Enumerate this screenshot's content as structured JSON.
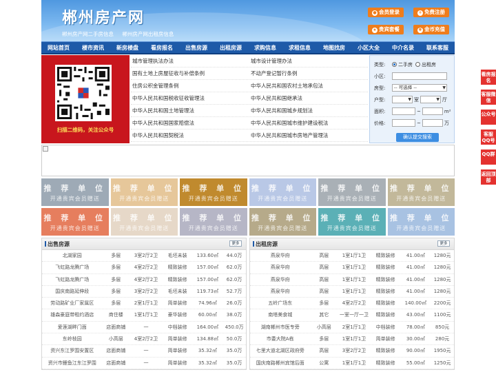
{
  "header": {
    "logo": "郴州房产网",
    "slogan1": "郴州房产网二手房信息",
    "slogan2": "郴州房产网出租房信息",
    "buttons": [
      {
        "label": "会员登录",
        "icon": "user-icon"
      },
      {
        "label": "免费注册",
        "icon": "register-icon"
      },
      {
        "label": "贵宾套餐",
        "icon": "vip-icon"
      },
      {
        "label": "金币充值",
        "icon": "coin-icon"
      }
    ]
  },
  "nav": [
    "网站首页",
    "楼市资讯",
    "新房楼盘",
    "看房报名",
    "出售房源",
    "出租房源",
    "求购信息",
    "求租信息",
    "地图找房",
    "小区大全",
    "中介名录",
    "联系客服"
  ],
  "qr": {
    "caption": "扫描二维码，关注公众号"
  },
  "links": [
    [
      "城市管理执法办法",
      "城市设计管理办法"
    ],
    [
      "国有土地上房屋征收与补偿条例",
      "不动产登记暂行条例"
    ],
    [
      "住房公积金管理条例",
      "中华人民共和国农村土地承包法"
    ],
    [
      "中华人民共和国税收征收管理法",
      "中华人民共和国继承法"
    ],
    [
      "中华人民共和国土地管理法",
      "中华人民共和国城乡规划法"
    ],
    [
      "中华人民共和国国家赔偿法",
      "中华人民共和国城市维护建设税法"
    ],
    [
      "中华人民共和国契税法",
      "中华人民共和国城市房地产管理法"
    ]
  ],
  "search": {
    "type_label": "类型:",
    "type_options": [
      "二手房",
      "出租房"
    ],
    "community_label": "小区:",
    "housetype_label": "房型:",
    "housetype_value": "-- 可选择 --",
    "layout_label": "户型:",
    "room_unit": "室",
    "hall_unit": "厅",
    "area_label": "面积:",
    "area_unit": "m²",
    "price_label": "价格:",
    "price_sep": "~",
    "price_unit": "万",
    "submit": "确认提交搜索"
  },
  "ads": {
    "title": "推 荐 单 位",
    "subtitle": "开通贵宾会员赠送",
    "colors": [
      "#9eaab6",
      "#e6c79a",
      "#c08a2e",
      "#b9c8e6",
      "#a9b0b6",
      "#c2b89a",
      "#e67e5e",
      "#e6d8c8",
      "#b6b6c6",
      "#b6aa8a",
      "#5bb0b6",
      "#a8c2e2"
    ]
  },
  "sale": {
    "title": "出售房源",
    "more": "更多",
    "rows": [
      [
        "北湖家园",
        "多层",
        "3室2厅2卫",
        "毛坯未装",
        "133.60㎡",
        "44.0万"
      ],
      [
        "飞虹路龙腾广场",
        "多层",
        "4室2厅2卫",
        "精致装修",
        "157.00㎡",
        "62.0万"
      ],
      [
        "飞虹路龙腾广场",
        "多层",
        "4室2厅2卫",
        "精致装修",
        "157.00㎡",
        "62.0万"
      ],
      [
        "国庆南路延伸段",
        "多层",
        "3室2厅2卫",
        "毛坯未装",
        "119.73㎡",
        "52.7万"
      ],
      [
        "劳动路矿业厂家属区",
        "多层",
        "2室1厅1卫",
        "简单装修",
        "74.96㎡",
        "26.0万"
      ],
      [
        "雄森豪庭带租约酒店",
        "商住楼",
        "1室1厅1卫",
        "豪华装修",
        "60.00㎡",
        "38.0万"
      ],
      [
        "爱莲湖畔门面",
        "店面商铺",
        "一",
        "中档装修",
        "164.00㎡",
        "450.0万"
      ],
      [
        "东岭枝园",
        "小高层",
        "4室2厅2卫",
        "简单装修",
        "134.88㎡",
        "50.0万"
      ],
      [
        "资兴东江罗围安置区",
        "店面商铺",
        "一",
        "简单装修",
        "35.32㎡",
        "35.0万"
      ],
      [
        "资兴市鲤鱼江东江罗围",
        "店面商铺",
        "一",
        "简单装修",
        "35.32㎡",
        "35.0万"
      ]
    ]
  },
  "rent": {
    "title": "出租房源",
    "more": "更多",
    "rows": [
      [
        "燕泉华府",
        "高层",
        "1室1厅1卫",
        "精致装修",
        "41.00㎡",
        "1280元"
      ],
      [
        "燕泉华府",
        "高层",
        "1室1厅1卫",
        "精致装修",
        "41.00㎡",
        "1280元"
      ],
      [
        "燕泉华府",
        "高层",
        "1室1厅1卫",
        "精致装修",
        "41.00㎡",
        "1280元"
      ],
      [
        "燕泉华府",
        "高层",
        "1室1厅1卫",
        "精致装修",
        "41.00㎡",
        "1280元"
      ],
      [
        "五岭广场东",
        "多层",
        "4室2厅2卫",
        "精致装修",
        "140.00㎡",
        "2200元"
      ],
      [
        "南塔美食城",
        "其它",
        "一室一厅一卫",
        "精致装修",
        "43.00㎡",
        "1100元"
      ],
      [
        "湖南郴州市医专旁",
        "小高层",
        "2室1厅1卫",
        "中档装修",
        "78.00㎡",
        "850元"
      ],
      [
        "市委大院A栋",
        "多层",
        "1室1厅1卫",
        "简单装修",
        "30.00㎡",
        "280元"
      ],
      [
        "七里大道北湖区政府旁",
        "高层",
        "3室2厅2卫",
        "精致装修",
        "90.00㎡",
        "1950元"
      ],
      [
        "国庆南路郴州宾馆后面",
        "公寓",
        "1室1厅1卫",
        "精致装修",
        "55.00㎡",
        "1250元"
      ]
    ]
  },
  "side": [
    "看房报名",
    "客服微信",
    "公众号",
    "客服QQ号",
    "QQ群",
    "返回顶部"
  ]
}
